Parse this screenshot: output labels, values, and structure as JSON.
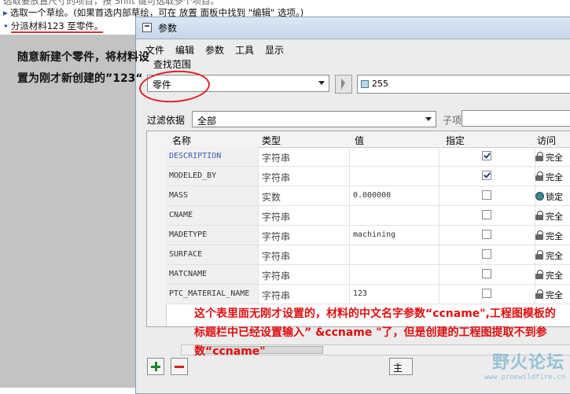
{
  "messages": {
    "line1": "选取要放置尺寸的项目，按 Shift 键可选取多个项目。",
    "line2": "选取一个草绘。(如果首选内部草绘，可在 放置 面板中找到 \"编辑\" 选项。)",
    "line3": "分派材料123 至零件。"
  },
  "annotation_left": "随意新建个零件，将材料设置为刚才新创建的”123“",
  "annotation_bottom": "这个表里面无刚才设置的，材料的中文名字参数“ccname\",工程图模板的标题栏中已经设置输入” &ccname \"了，但是创建的工程图提取不到参数“ccname\"",
  "window": {
    "title": "参数",
    "menu": [
      "文件",
      "编辑",
      "参数",
      "工具",
      "显示"
    ],
    "search_scope_label": "查找范围",
    "scope_value": "零件",
    "selection_value": "255",
    "filter_label": "过滤依据",
    "filter_value": "全部",
    "sub_label": "子项",
    "main_button": "主"
  },
  "table": {
    "columns": [
      "名称",
      "类型",
      "值",
      "指定",
      "访问"
    ],
    "rows": [
      {
        "name": "DESCRIPTION",
        "type": "字符串",
        "value": "",
        "designated": true,
        "access": "完全",
        "lock": "open"
      },
      {
        "name": "MODELED_BY",
        "type": "字符串",
        "value": "",
        "designated": true,
        "access": "完全",
        "lock": "open"
      },
      {
        "name": "MASS",
        "type": "实数",
        "value": "0.000000",
        "designated": false,
        "access": "锁定",
        "lock": "locked"
      },
      {
        "name": "CNAME",
        "type": "字符串",
        "value": "",
        "designated": false,
        "access": "完全",
        "lock": "open"
      },
      {
        "name": "MADETYPE",
        "type": "字符串",
        "value": "machining",
        "designated": false,
        "access": "完全",
        "lock": "open"
      },
      {
        "name": "SURFACE",
        "type": "字符串",
        "value": "",
        "designated": false,
        "access": "完全",
        "lock": "open"
      },
      {
        "name": "MATCNAME",
        "type": "字符串",
        "value": "",
        "designated": false,
        "access": "完全",
        "lock": "open"
      },
      {
        "name": "PTC_MATERIAL_NAME",
        "type": "字符串",
        "value": "123",
        "designated": false,
        "access": "完全",
        "lock": "open"
      }
    ]
  },
  "watermark": "野火论坛",
  "watermark_url": "www.proewildfire.cn"
}
